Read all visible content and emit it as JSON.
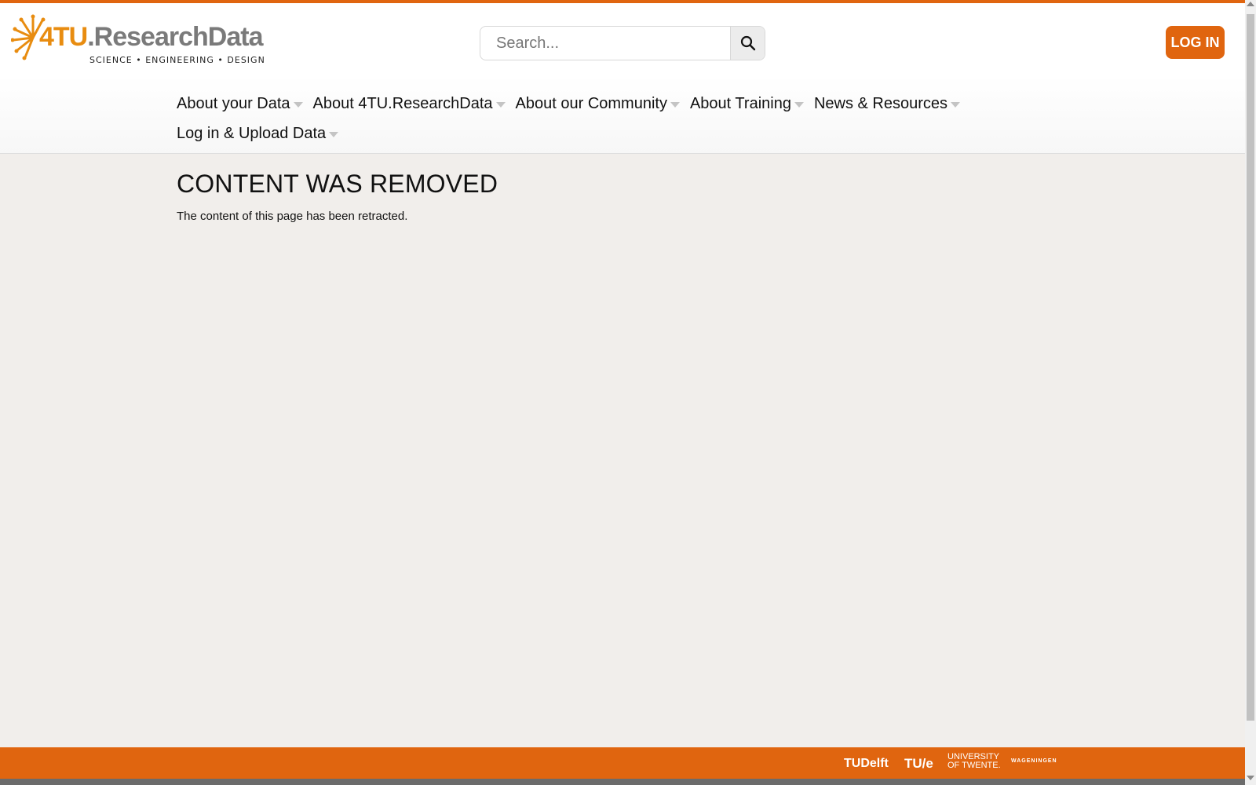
{
  "header": {
    "logo": {
      "name": "4TU.ResearchData",
      "name_part1": "4TU",
      "name_part2": ".ResearchData",
      "tagline": "SCIENCE • ENGINEERING • DESIGN"
    },
    "search": {
      "placeholder": "Search...",
      "icon": "search-icon"
    },
    "login_label": "LOG IN"
  },
  "nav": {
    "items": [
      {
        "label": "About your Data"
      },
      {
        "label": "About 4TU.ResearchData"
      },
      {
        "label": "About our Community"
      },
      {
        "label": "About Training"
      },
      {
        "label": "News & Resources"
      },
      {
        "label": "Log in & Upload Data"
      }
    ]
  },
  "main": {
    "title": "CONTENT WAS REMOVED",
    "text": "The content of this page has been retracted."
  },
  "footer": {
    "partners": [
      {
        "label": "TUDelft"
      },
      {
        "label": "TU/e"
      },
      {
        "label_line1": "UNIVERSITY",
        "label_line2": "OF TWENTE."
      },
      {
        "label": "WAGENINGEN"
      }
    ]
  },
  "colors": {
    "accent": "#e0650f",
    "logo_orange": "#e88c10",
    "logo_grey": "#7a7a7a",
    "page_bg": "#f1eeeb"
  }
}
